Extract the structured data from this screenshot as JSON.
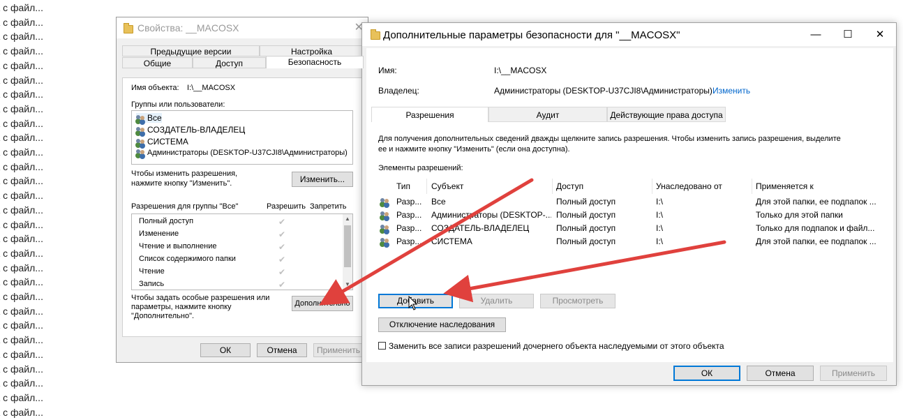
{
  "background": {
    "items": [
      "ка с файл...",
      "ка с файл...",
      "ка с файл...",
      "ка с файл...",
      "ка с файл...",
      "ка с файл...",
      "ка с файл...",
      "ка с файл...",
      "ка с файл...",
      "ка с файл...",
      "ка с файл...",
      "ка с файл...",
      "ка с файл...",
      "ка с файл...",
      "ка с файл...",
      "ка с файл...",
      "ка с файл...",
      "ка с файл...",
      "ка с файл...",
      "ка с файл...",
      "ка с файл...",
      "ка с файл...",
      "ка с файл...",
      "ка с файл...",
      "ка с файл...",
      "ка с файл...",
      "ка с файл...",
      "ка с файл...",
      "ка с файл..."
    ]
  },
  "properties": {
    "title": "Свойства: __MACOSX",
    "tabs_row1": [
      "Предыдущие версии",
      "Настройка"
    ],
    "tabs_row2": [
      "Общие",
      "Доступ",
      "Безопасность"
    ],
    "object_label": "Имя объекта:",
    "object_value": "I:\\__MACOSX",
    "groups_label": "Группы или пользователи:",
    "groups": [
      "Все",
      "СОЗДАТЕЛЬ-ВЛАДЕЛЕЦ",
      "СИСТЕМА",
      "Администраторы (DESKTOP-U37CJI8\\Администраторы)"
    ],
    "change_hint_1": "Чтобы изменить разрешения,",
    "change_hint_2": "нажмите кнопку \"Изменить\".",
    "change_button": "Изменить...",
    "perm_for": "Разрешения для группы \"Все\"",
    "allow": "Разрешить",
    "deny": "Запретить",
    "perms": [
      "Полный доступ",
      "Изменение",
      "Чтение и выполнение",
      "Список содержимого папки",
      "Чтение",
      "Запись"
    ],
    "adv_hint_1": "Чтобы задать особые разрешения или",
    "adv_hint_2": "параметры, нажмите кнопку",
    "adv_hint_3": "\"Дополнительно\".",
    "advanced_button": "Дополнительно",
    "ok": "ОК",
    "cancel": "Отмена",
    "apply": "Применить"
  },
  "advanced": {
    "title": "Дополнительные параметры безопасности  для \"__MACOSX\"",
    "controls": {
      "minimize": "—",
      "maximize": "☐",
      "close": "✕"
    },
    "name_label": "Имя:",
    "name_value": "I:\\__MACOSX",
    "owner_label": "Владелец:",
    "owner_value": "Администраторы (DESKTOP-U37CJI8\\Администраторы)",
    "owner_change": "Изменить",
    "tabs": [
      "Разрешения",
      "Аудит",
      "Действующие права доступа"
    ],
    "info_1": "Для получения дополнительных сведений дважды щелкните запись разрешения. Чтобы изменить запись разрешения, выделите",
    "info_2": "ее и нажмите кнопку \"Изменить\" (если она доступна).",
    "entries_label": "Элементы разрешений:",
    "columns": [
      "Тип",
      "Субъект",
      "Доступ",
      "Унаследовано от",
      "Применяется к"
    ],
    "rows": [
      {
        "type": "Разр...",
        "subject": "Все",
        "access": "Полный доступ",
        "inherited": "I:\\",
        "applies": "Для этой папки, ее подпапок ..."
      },
      {
        "type": "Разр...",
        "subject": "Администраторы (DESKTOP-...",
        "access": "Полный доступ",
        "inherited": "I:\\",
        "applies": "Только для этой папки"
      },
      {
        "type": "Разр...",
        "subject": "СОЗДАТЕЛЬ-ВЛАДЕЛЕЦ",
        "access": "Полный доступ",
        "inherited": "I:\\",
        "applies": "Только для подпапок и файл..."
      },
      {
        "type": "Разр...",
        "subject": "СИСТЕМА",
        "access": "Полный доступ",
        "inherited": "I:\\",
        "applies": "Для этой папки, ее подпапок ..."
      }
    ],
    "add_button": "Добавить",
    "remove_button": "Удалить",
    "view_button": "Просмотреть",
    "disable_inherit_button": "Отключение наследования",
    "replace_checkbox": "Заменить все записи разрешений дочернего объекта наследуемыми от этого объекта",
    "ok": "ОК",
    "cancel": "Отмена",
    "apply": "Применить"
  },
  "colors": {
    "accent": "#0078d7",
    "arrow": "#e0413d",
    "link": "#0066cc"
  }
}
